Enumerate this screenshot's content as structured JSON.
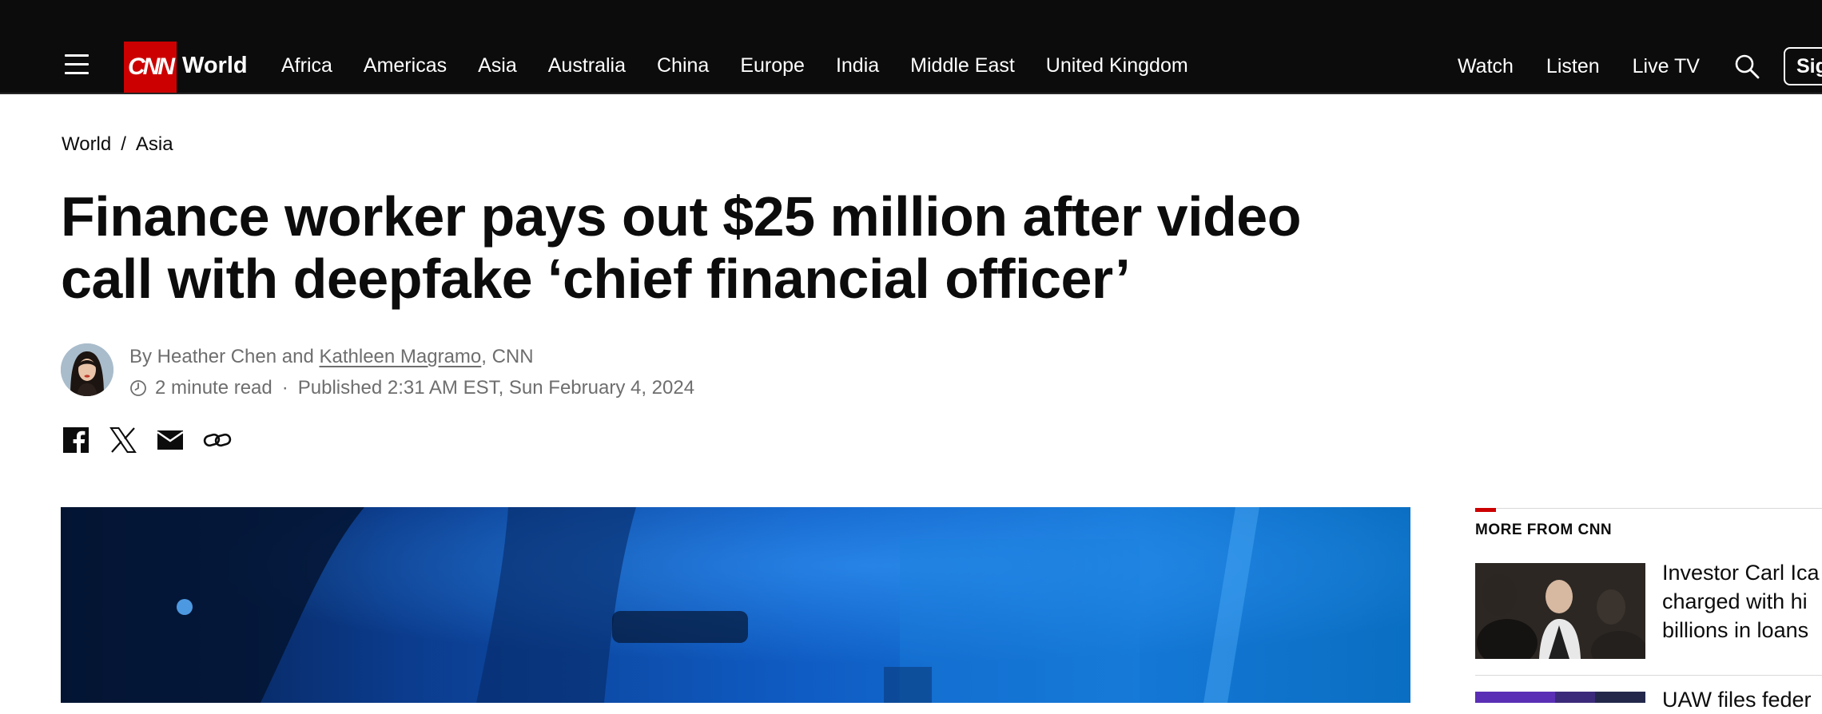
{
  "header": {
    "menu_icon": "hamburger-menu-icon",
    "logo_text": "CNN",
    "section": "World",
    "nav_items": [
      "Africa",
      "Americas",
      "Asia",
      "Australia",
      "China",
      "Europe",
      "India",
      "Middle East",
      "United Kingdom"
    ],
    "right_nav": [
      "Watch",
      "Listen",
      "Live TV"
    ],
    "search_icon": "search-icon",
    "signin_label": "Sig"
  },
  "breadcrumb": {
    "items": [
      "World",
      "Asia"
    ],
    "separator": "/"
  },
  "article": {
    "headline_line1": "Finance worker pays out $25 million after video",
    "headline_line2": "call with deepfake ‘chief financial officer’",
    "byline_prefix": "By Heather Chen and ",
    "byline_link": "Kathleen Magramo",
    "byline_suffix": ", CNN",
    "read_time": "2 minute read",
    "meta_separator": "·",
    "published": "Published 2:31 AM EST, Sun February 4, 2024"
  },
  "share_icons": [
    "facebook-icon",
    "x-twitter-icon",
    "email-icon",
    "link-icon"
  ],
  "rail": {
    "title": "MORE FROM CNN",
    "items": [
      {
        "lines": [
          "Investor Carl Ica",
          "charged with hi",
          "billions in loans"
        ]
      },
      {
        "lines": [
          "UAW files feder"
        ]
      }
    ]
  },
  "colors": {
    "brand_red": "#cc0000",
    "header_bg": "#0c0c0c",
    "meta_gray": "#6e6e6e"
  }
}
